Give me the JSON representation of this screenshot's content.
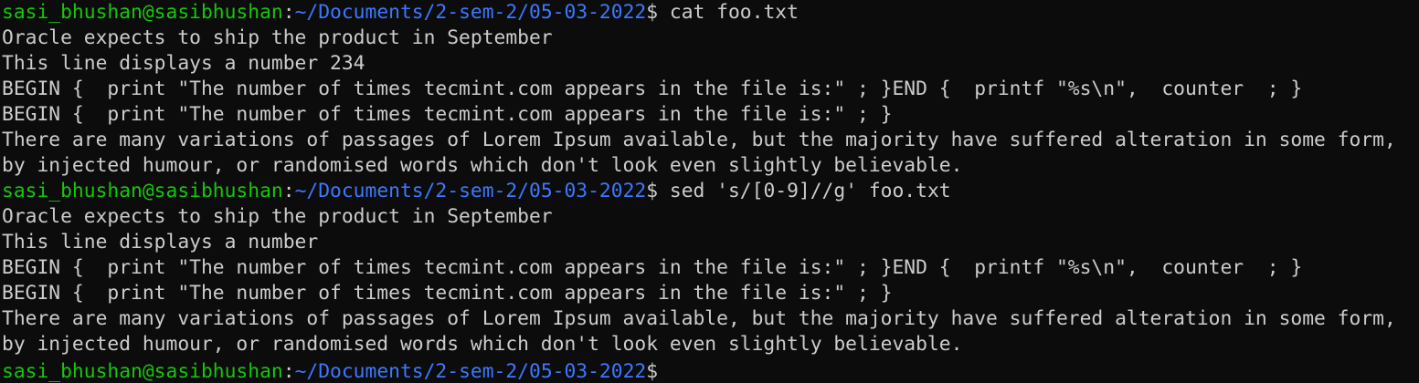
{
  "prompt": {
    "user_host": "sasi_bhushan@sasibhushan",
    "colon": ":",
    "path": "~/Documents/2-sem-2/05-03-2022",
    "dollar": "$"
  },
  "commands": [
    " cat foo.txt",
    " sed 's/[0-9]//g' foo.txt",
    ""
  ],
  "outputs": [
    [
      "Oracle expects to ship the product in September",
      "This line displays a number 234",
      "BEGIN {  print \"The number of times tecmint.com appears in the file is:\" ; }END {  printf \"%s\\n\",  counter  ; }",
      "BEGIN {  print \"The number of times tecmint.com appears in the file is:\" ; }",
      "There are many variations of passages of Lorem Ipsum available, but the majority have suffered alteration in some form,",
      "by injected humour, or randomised words which don't look even slightly believable."
    ],
    [
      "Oracle expects to ship the product in September",
      "This line displays a number",
      "BEGIN {  print \"The number of times tecmint.com appears in the file is:\" ; }END {  printf \"%s\\n\",  counter  ; }",
      "BEGIN {  print \"The number of times tecmint.com appears in the file is:\" ; }",
      "There are many variations of passages of Lorem Ipsum available, but the majority have suffered alteration in some form,",
      "by injected humour, or randomised words which don't look even slightly believable."
    ]
  ],
  "colors": {
    "background": "#0c0c0c",
    "text": "#cccccc",
    "user_host": "#16c60c",
    "path": "#3b78ff"
  }
}
